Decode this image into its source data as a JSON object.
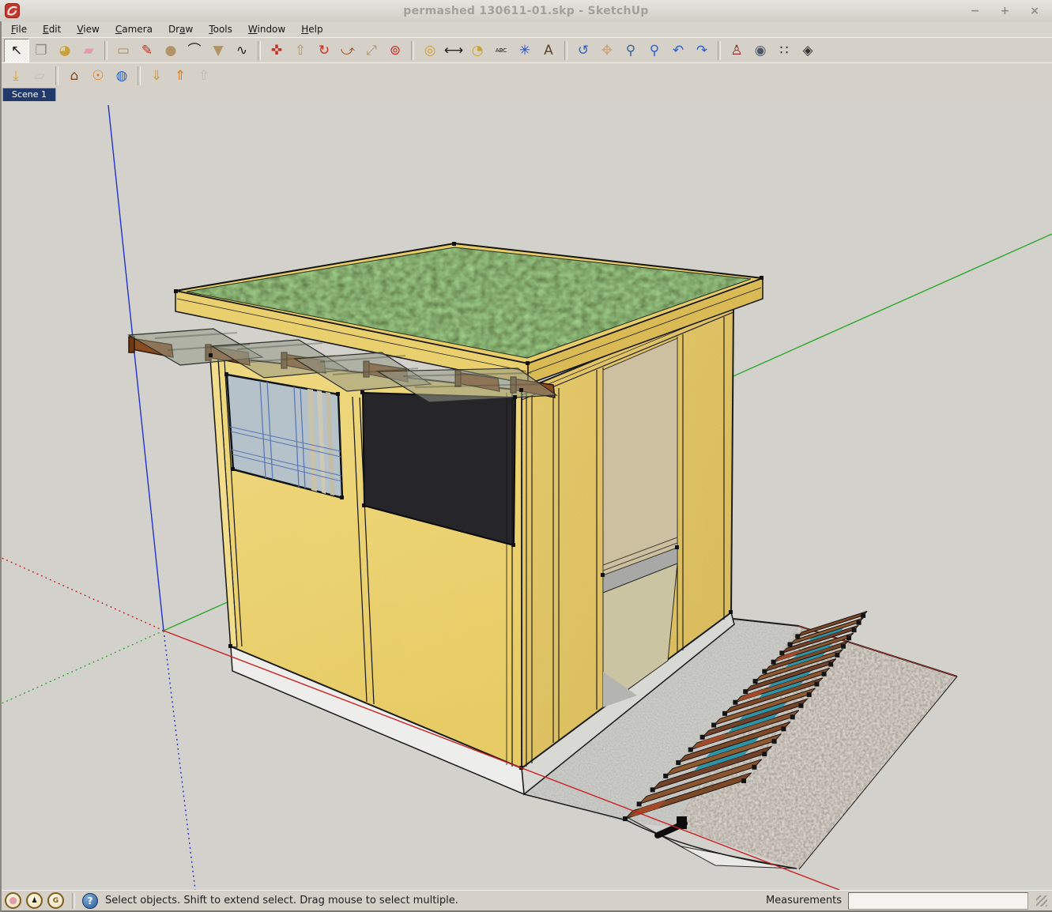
{
  "window": {
    "title": "permashed 130611-01.skp - SketchUp",
    "controls": {
      "minimize": "−",
      "maximize": "+",
      "close": "×"
    }
  },
  "menu": {
    "items": [
      {
        "pre": "",
        "key": "F",
        "post": "ile"
      },
      {
        "pre": "",
        "key": "E",
        "post": "dit"
      },
      {
        "pre": "",
        "key": "V",
        "post": "iew"
      },
      {
        "pre": "",
        "key": "C",
        "post": "amera"
      },
      {
        "pre": "Dr",
        "key": "a",
        "post": "w"
      },
      {
        "pre": "",
        "key": "T",
        "post": "ools"
      },
      {
        "pre": "",
        "key": "W",
        "post": "indow"
      },
      {
        "pre": "",
        "key": "H",
        "post": "elp"
      }
    ]
  },
  "toolbar_main": {
    "items": [
      {
        "name": "select-tool",
        "glyph": "↖",
        "color": "#111111",
        "pressed": true
      },
      {
        "name": "make-component-tool",
        "glyph": "❐",
        "color": "#8a8a84"
      },
      {
        "name": "paint-bucket-tool",
        "glyph": "◕",
        "color": "#c9a23a"
      },
      {
        "name": "eraser-tool",
        "glyph": "▰",
        "color": "#e49cab"
      },
      {
        "type": "sep"
      },
      {
        "name": "rectangle-tool",
        "glyph": "▭",
        "color": "#a98b62"
      },
      {
        "name": "line-tool",
        "glyph": "✎",
        "color": "#c62f20"
      },
      {
        "name": "circle-tool",
        "glyph": "●",
        "color": "#b29468"
      },
      {
        "name": "arc-tool",
        "glyph": "⌒",
        "color": "#222222"
      },
      {
        "name": "polygon-tool",
        "glyph": "▼",
        "color": "#b29468"
      },
      {
        "name": "freehand-tool",
        "glyph": "∿",
        "color": "#222222"
      },
      {
        "type": "sep"
      },
      {
        "name": "move-tool",
        "glyph": "✜",
        "color": "#c62f20"
      },
      {
        "name": "push-pull-tool",
        "glyph": "⇧",
        "color": "#b29468"
      },
      {
        "name": "rotate-tool",
        "glyph": "↻",
        "color": "#c62f20"
      },
      {
        "name": "follow-me-tool",
        "glyph": "⤻",
        "color": "#a5542c"
      },
      {
        "name": "scale-tool",
        "glyph": "⤢",
        "color": "#b29468"
      },
      {
        "name": "offset-tool",
        "glyph": "⊚",
        "color": "#c62f20"
      },
      {
        "type": "sep"
      },
      {
        "name": "tape-measure-tool",
        "glyph": "◎",
        "color": "#c9a23a"
      },
      {
        "name": "dimension-tool",
        "glyph": "⟷",
        "color": "#222222"
      },
      {
        "name": "protractor-tool",
        "glyph": "◔",
        "color": "#c9a23a"
      },
      {
        "name": "text-tool",
        "glyph": "ABC",
        "color": "#111111",
        "size": "7px"
      },
      {
        "name": "axes-tool",
        "glyph": "✳",
        "color": "#2b4fc1"
      },
      {
        "name": "3d-text-tool",
        "glyph": "A",
        "color": "#5a4526"
      },
      {
        "type": "sep"
      },
      {
        "name": "orbit-tool",
        "glyph": "↺",
        "color": "#2b62c9"
      },
      {
        "name": "pan-tool",
        "glyph": "✥",
        "color": "#c9a87e"
      },
      {
        "name": "zoom-tool",
        "glyph": "⚲",
        "color": "#3c648e"
      },
      {
        "name": "zoom-extents-tool",
        "glyph": "⚲",
        "color": "#2b62c9"
      },
      {
        "name": "previous-view-tool",
        "glyph": "↶",
        "color": "#2b62c9"
      },
      {
        "name": "next-view-tool",
        "glyph": "↷",
        "color": "#2b62c9"
      },
      {
        "type": "sep"
      },
      {
        "name": "position-camera-tool",
        "glyph": "♙",
        "color": "#8a2020"
      },
      {
        "name": "look-around-tool",
        "glyph": "◉",
        "color": "#4c5866"
      },
      {
        "name": "walk-tool",
        "glyph": "∷",
        "color": "#161616"
      },
      {
        "name": "section-plane-tool",
        "glyph": "◈",
        "color": "#333333"
      }
    ]
  },
  "toolbar_google": {
    "items": [
      {
        "name": "get-current-view-button",
        "glyph": "⤓",
        "color": "#e0a21a"
      },
      {
        "name": "toggle-terrain-button",
        "glyph": "▱",
        "color": "#9a9a94",
        "disabled": true
      },
      {
        "type": "sep"
      },
      {
        "name": "photo-textures-button",
        "glyph": "⌂",
        "color": "#7a4a20"
      },
      {
        "name": "add-location-button",
        "glyph": "☉",
        "color": "#e07818"
      },
      {
        "name": "google-earth-button",
        "glyph": "◍",
        "color": "#2b62c9"
      },
      {
        "type": "sep"
      },
      {
        "name": "get-models-button",
        "glyph": "⇓",
        "color": "#c9a23a"
      },
      {
        "name": "upload-model-button",
        "glyph": "⇑",
        "color": "#e07818"
      },
      {
        "name": "share-component-button",
        "glyph": "⇧",
        "color": "#9a9a94",
        "disabled": true
      }
    ]
  },
  "scene_tab": {
    "label": "Scene 1"
  },
  "statusbar": {
    "icons": [
      {
        "name": "geo-location-status-icon",
        "glyph": "⬤",
        "color": "#e59aa8"
      },
      {
        "name": "credit-attribution-status-icon",
        "glyph": "♟",
        "color": "#1a1a1a"
      },
      {
        "name": "sign-in-status-icon",
        "glyph": "G",
        "color": "#7d5c1e"
      }
    ],
    "help_glyph": "?",
    "message": "Select objects. Shift to extend select. Drag mouse to select multiple.",
    "measurements_label": "Measurements",
    "measurements_value": ""
  },
  "viewport": {
    "axis_colors": {
      "x_red": "#cc2222",
      "y_green": "#2fa82f",
      "z_blue": "#2233cc"
    },
    "model_colors": {
      "wall_yellow": "#e9cf6d",
      "wall_yellow_shaded": "#dcbe5c",
      "roof_grass_green": "#4e5f35",
      "roof_trim_yellow": "#e7cc68",
      "window_glass_blue": "#b6c2ca",
      "window_frame_blue": "#5b79b5",
      "dark_opening": "#26262a",
      "awning_glass": "#94998666",
      "bracket_brown": "#8a4b1e",
      "plank_brown": "#7b4927",
      "plank_teal": "#2f93a7",
      "concrete_pad_gray": "#9c9b97",
      "gravel_gray": "#7d7873",
      "base_concrete_white": "#ededeb",
      "door_panel_tan": "#cdc0a0"
    }
  }
}
